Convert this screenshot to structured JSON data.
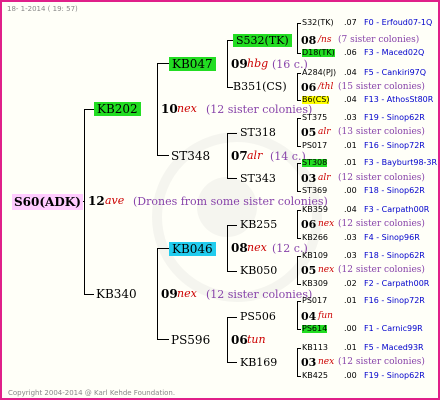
{
  "date": "18-  1-2014 ( 19: 57)",
  "copyright": "Copyright 2004-2014 @ Karl Kehde Foundation.",
  "root": {
    "name": "S60(ADK)",
    "gen": "12",
    "year": "ave",
    "note": "(Drones from some sister colonies)"
  },
  "lvl1": [
    {
      "name": "KB202",
      "gen": "10",
      "year": "nex",
      "note": "(12 sister colonies)"
    },
    {
      "name": "KB340",
      "gen": "09",
      "year": "nex",
      "note": "(12 sister colonies)"
    }
  ],
  "lvl2": [
    {
      "name": "KB047",
      "gen": "09",
      "year": "hbg",
      "note": "(16 c.)"
    },
    {
      "name": "ST348",
      "gen": "07",
      "year": "alr",
      "note": "(14 c.)"
    },
    {
      "name": "KB046",
      "gen": "08",
      "year": "nex",
      "note": "(12 c.)"
    },
    {
      "name": "PS596",
      "gen": "06",
      "year": "tun",
      "note": ""
    }
  ],
  "lvl3": [
    {
      "name": "S532(TK)",
      "gen": "08",
      "year": "/ns",
      "note": "(7 sister colonies)"
    },
    {
      "name": "B351(CS)",
      "gen": "06",
      "year": "/thl",
      "note": "(15 sister colonies)"
    },
    {
      "name": "ST318",
      "gen": "05",
      "year": "alr",
      "note": "(13 sister colonies)"
    },
    {
      "name": "ST343",
      "gen": "03",
      "year": "alr",
      "note": "(12 sister colonies)"
    },
    {
      "name": "KB255",
      "gen": "06",
      "year": "nex",
      "note": "(12 sister colonies)"
    },
    {
      "name": "KB050",
      "gen": "05",
      "year": "nex",
      "note": "(12 sister colonies)"
    },
    {
      "name": "PS506",
      "gen": "04",
      "year": "fun",
      "note": ""
    },
    {
      "name": "KB169",
      "gen": "03",
      "year": "nex",
      "note": "(12 sister colonies)"
    }
  ],
  "lvl4": [
    {
      "name": "S32(TK)",
      "gen": ".07",
      "ref": "F0 - Erfoud07-1Q"
    },
    {
      "name": "D18(TK)",
      "gen": ".06",
      "ref": "F3 - Maced02Q"
    },
    {
      "name": "A284(PJ)",
      "gen": ".04",
      "ref": "F5 - Cankiri97Q"
    },
    {
      "name": "B6(CS)",
      "gen": ".04",
      "ref": "F13 - AthosSt80R"
    },
    {
      "name": "ST375",
      "gen": ".03",
      "ref": "F19 - Sinop62R"
    },
    {
      "name": "PS017",
      "gen": ".01",
      "ref": "F16 - Sinop72R"
    },
    {
      "name": "ST308",
      "gen": ".01",
      "ref": "F3 - Bayburt98-3R"
    },
    {
      "name": "ST369",
      "gen": ".00",
      "ref": "F18 - Sinop62R"
    },
    {
      "name": "KB359",
      "gen": ".04",
      "ref": "F3 - Carpath00R"
    },
    {
      "name": "KB266",
      "gen": ".03",
      "ref": "F4 - Sinop96R"
    },
    {
      "name": "KB109",
      "gen": ".03",
      "ref": "F18 - Sinop62R"
    },
    {
      "name": "KB309",
      "gen": ".02",
      "ref": "F2 - Carpath00R"
    },
    {
      "name": "PS017",
      "gen": ".01",
      "ref": "F16 - Sinop72R"
    },
    {
      "name": "PS614",
      "gen": ".00",
      "ref": "F1 - Carnic99R"
    },
    {
      "name": "KB113",
      "gen": ".01",
      "ref": "F5 - Maced93R"
    },
    {
      "name": "KB425",
      "gen": ".00",
      "ref": "F19 - Sinop62R"
    }
  ]
}
